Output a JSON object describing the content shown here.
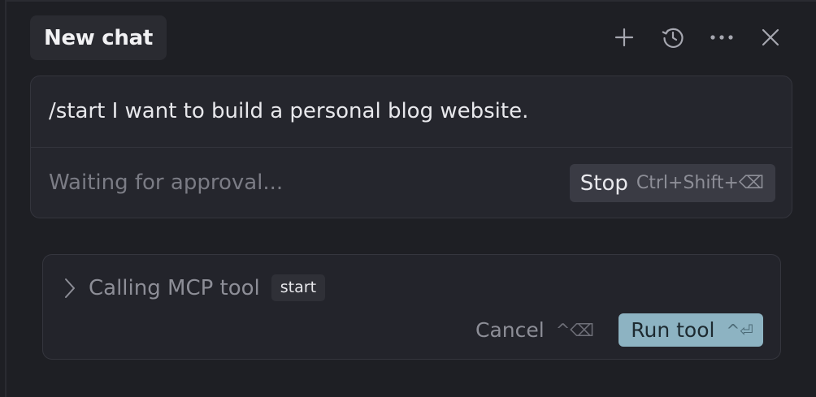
{
  "header": {
    "tab_title": "New chat",
    "icons": [
      "plus-icon",
      "history-icon",
      "more-icon",
      "close-icon"
    ]
  },
  "prompt": {
    "text": "/start I want to build a personal blog website.",
    "status": "Waiting for approval...",
    "stop_label": "Stop",
    "stop_shortcut": "Ctrl+Shift+⌫"
  },
  "tool_call": {
    "title": "Calling MCP tool",
    "tool_name": "start",
    "cancel_label": "Cancel",
    "cancel_shortcut": "^⌫",
    "run_label": "Run tool",
    "run_shortcut": "^⏎"
  },
  "colors": {
    "background": "#1e1f24",
    "card": "#25262d",
    "run_button": "#8db3c2",
    "stop_button": "#3a3b44"
  }
}
